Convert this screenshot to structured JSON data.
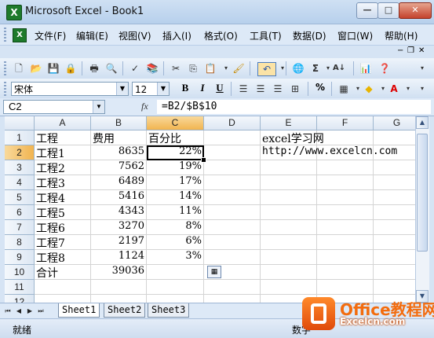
{
  "window": {
    "title": "Microsoft Excel - Book1"
  },
  "menu": {
    "items": [
      "文件(F)",
      "编辑(E)",
      "视图(V)",
      "插入(I)",
      "格式(O)",
      "工具(T)",
      "数据(D)",
      "窗口(W)",
      "帮助(H)"
    ]
  },
  "format_toolbar": {
    "font": "宋体",
    "size": "12",
    "bold": "B",
    "italic": "I",
    "underline": "U",
    "percent": "%"
  },
  "formula_bar": {
    "name_box": "C2",
    "fx": "fx",
    "formula": "=B2/$B$10"
  },
  "grid": {
    "columns": [
      "A",
      "B",
      "C",
      "D",
      "E",
      "F",
      "G"
    ],
    "rows": [
      "1",
      "2",
      "3",
      "4",
      "5",
      "6",
      "7",
      "8",
      "9",
      "10",
      "11",
      "12"
    ],
    "cells": {
      "A1": "工程",
      "B1": "费用",
      "C1": "百分比",
      "E1": "excel学习网",
      "A2": "工程1",
      "B2": "8635",
      "C2": "22%",
      "E2": "http://www.excelcn.com",
      "A3": "工程2",
      "B3": "7562",
      "C3": "19%",
      "A4": "工程3",
      "B4": "6489",
      "C4": "17%",
      "A5": "工程4",
      "B5": "5416",
      "C5": "14%",
      "A6": "工程5",
      "B6": "4343",
      "C6": "11%",
      "A7": "工程6",
      "B7": "3270",
      "C7": "8%",
      "A8": "工程7",
      "B8": "2197",
      "C8": "6%",
      "A9": "工程8",
      "B9": "1124",
      "C9": "3%",
      "A10": "合计",
      "B10": "39036"
    }
  },
  "sheets": [
    "Sheet1",
    "Sheet2",
    "Sheet3"
  ],
  "status": {
    "left": "就绪",
    "right": "数字"
  },
  "watermark": {
    "title": "Office教程网",
    "url": "www.office26.com",
    "sub": "Excelcn.com"
  }
}
